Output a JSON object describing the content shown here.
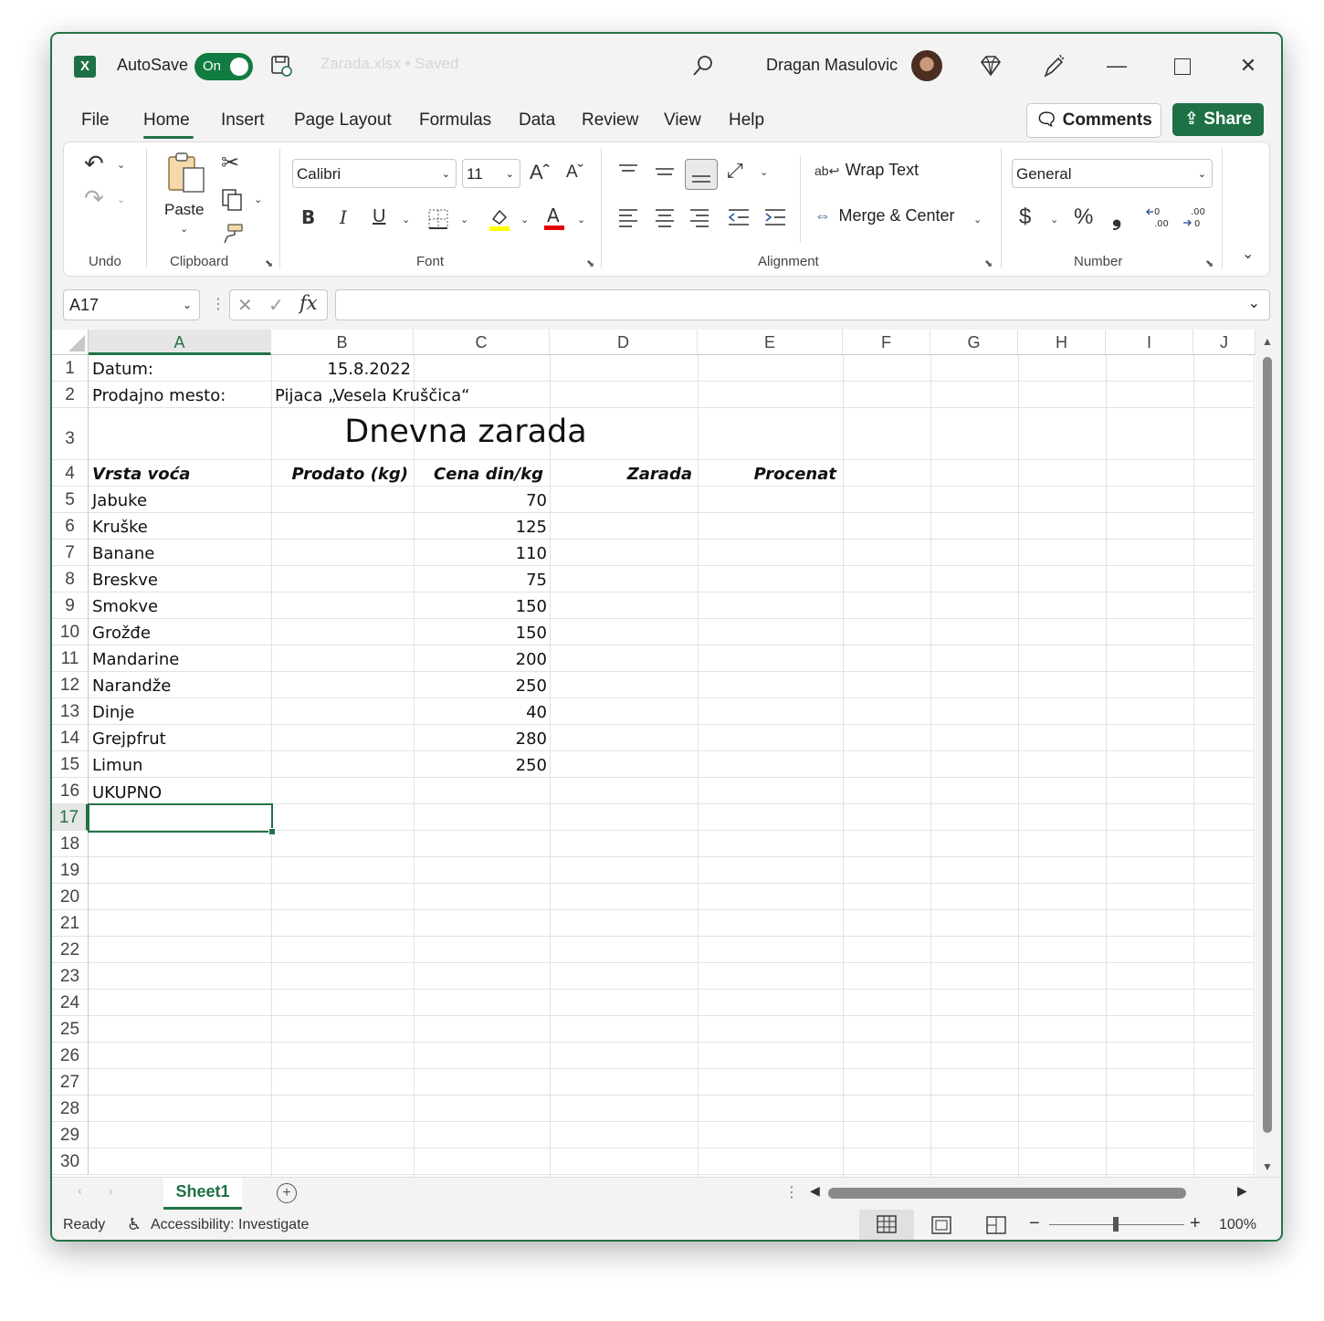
{
  "titlebar": {
    "app_icon": "X",
    "autosave_label": "AutoSave",
    "autosave_state": "On",
    "file_name": "Zarada.xlsx • Saved",
    "user_name": "Dragan Masulovic"
  },
  "tabs": [
    "File",
    "Home",
    "Insert",
    "Page Layout",
    "Formulas",
    "Data",
    "Review",
    "View",
    "Help"
  ],
  "actions": {
    "comments": "Comments",
    "share": "Share"
  },
  "ribbon": {
    "groups": {
      "undo": "Undo",
      "clipboard": "Clipboard",
      "font": "Font",
      "alignment": "Alignment",
      "number": "Number"
    },
    "paste_label": "Paste",
    "font_name": "Calibri",
    "font_size": "11",
    "bold": "B",
    "italic": "I",
    "underline": "U",
    "wrap_text": "Wrap Text",
    "merge_center": "Merge & Center",
    "number_format": "General",
    "currency": "$",
    "percent": "%",
    "comma": "❟"
  },
  "formula_bar": {
    "name_box": "A17",
    "formula": ""
  },
  "columns": [
    "A",
    "B",
    "C",
    "D",
    "E",
    "F",
    "G",
    "H",
    "I",
    "J"
  ],
  "rows": [
    "1",
    "2",
    "3",
    "4",
    "5",
    "6",
    "7",
    "8",
    "9",
    "10",
    "11",
    "12",
    "13",
    "14",
    "15",
    "16",
    "17",
    "18",
    "19",
    "20",
    "21",
    "22",
    "23",
    "24",
    "25",
    "26",
    "27",
    "28",
    "29",
    "30"
  ],
  "cells": {
    "A1": "Datum:",
    "B1": "15.8.2022",
    "A2": "Prodajno mesto:",
    "B2": "Pijaca „Vesela Kruščica“",
    "title": "Dnevna zarada",
    "headers": [
      "Vrsta voća",
      "Prodato (kg)",
      "Cena din/kg",
      "Zarada",
      "Procenat"
    ],
    "fruits": [
      "Jabuke",
      "Kruške",
      "Banane",
      "Breskve",
      "Smokve",
      "Grožđe",
      "Mandarine",
      "Narandže",
      "Dinje",
      "Grejpfrut",
      "Limun"
    ],
    "prices": [
      "70",
      "125",
      "110",
      "75",
      "150",
      "150",
      "200",
      "250",
      "40",
      "280",
      "250"
    ],
    "A16": "UKUPNO"
  },
  "selected_cell": "A17",
  "sheet_tab": "Sheet1",
  "status": {
    "ready": "Ready",
    "accessibility": "Accessibility: Investigate",
    "zoom": "100%"
  },
  "colors": {
    "accent": "#217346",
    "share_bg": "#1e7145"
  }
}
